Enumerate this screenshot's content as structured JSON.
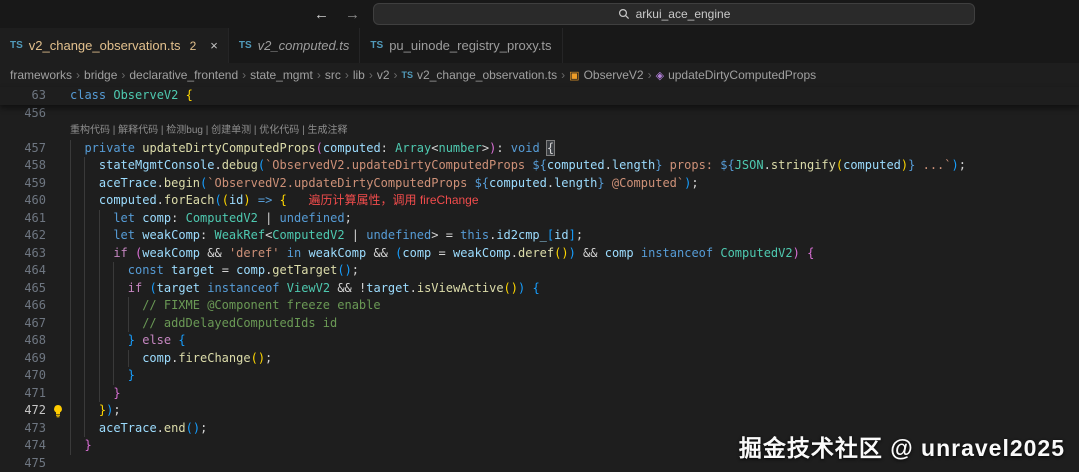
{
  "title_bar": {
    "back_arrow": "←",
    "forward_arrow": "→",
    "search_value": "arkui_ace_engine"
  },
  "tabs": [
    {
      "icon": "TS",
      "label": "v2_change_observation.ts",
      "badge": "2",
      "active": true,
      "close": "×"
    },
    {
      "icon": "TS",
      "label": "v2_computed.ts",
      "preview": true
    },
    {
      "icon": "TS",
      "label": "pu_uinode_registry_proxy.ts"
    }
  ],
  "breadcrumb": [
    {
      "label": "frameworks"
    },
    {
      "label": "bridge"
    },
    {
      "label": "declarative_frontend"
    },
    {
      "label": "state_mgmt"
    },
    {
      "label": "src"
    },
    {
      "label": "lib"
    },
    {
      "label": "v2"
    },
    {
      "label": "v2_change_observation.ts",
      "icon": "ts"
    },
    {
      "label": "ObserveV2",
      "icon": "class"
    },
    {
      "label": "updateDirtyComputedProps",
      "icon": "method"
    }
  ],
  "editor": {
    "codelens_actions": [
      "重构代码",
      "解释代码",
      "检测bug",
      "创建单测",
      "优化代码",
      "生成注释"
    ],
    "annotation": "遍历计算属性，调用 fireChange",
    "sticky_line": {
      "num": "63",
      "indent": 0,
      "tokens": [
        [
          "class",
          "kw"
        ],
        [
          " ",
          "df"
        ],
        [
          "ObserveV2",
          "ty"
        ],
        [
          " ",
          "df"
        ],
        [
          "{",
          "b1"
        ]
      ]
    },
    "lines": [
      {
        "num": "456",
        "indent": 0,
        "tokens": []
      },
      {
        "num": "",
        "lens": true
      },
      {
        "num": "457",
        "indent": 1,
        "tokens": [
          [
            "private",
            "kw"
          ],
          [
            " ",
            "df"
          ],
          [
            "updateDirtyComputedProps",
            "fn"
          ],
          [
            "(",
            "b2"
          ],
          [
            "computed",
            "vr"
          ],
          [
            ": ",
            "df"
          ],
          [
            "Array",
            "ty"
          ],
          [
            "<",
            "df"
          ],
          [
            "number",
            "ty"
          ],
          [
            ">",
            "df"
          ],
          [
            ")",
            "b2"
          ],
          [
            ": ",
            "df"
          ],
          [
            "void",
            "kw"
          ],
          [
            " ",
            "df"
          ],
          [
            "{",
            "bm"
          ]
        ]
      },
      {
        "num": "458",
        "indent": 2,
        "tokens": [
          [
            "stateMgmtConsole",
            "vr"
          ],
          [
            ".",
            "df"
          ],
          [
            "debug",
            "fn"
          ],
          [
            "(",
            "b3"
          ],
          [
            "`ObservedV2.updateDirtyComputedProps ",
            "st"
          ],
          [
            "${",
            "pt"
          ],
          [
            "computed",
            "vr"
          ],
          [
            ".",
            "df"
          ],
          [
            "length",
            "vr"
          ],
          [
            "}",
            "pt"
          ],
          [
            " props: ",
            "st"
          ],
          [
            "${",
            "pt"
          ],
          [
            "JSON",
            "ty"
          ],
          [
            ".",
            "df"
          ],
          [
            "stringify",
            "fn"
          ],
          [
            "(",
            "b1"
          ],
          [
            "computed",
            "vr"
          ],
          [
            ")",
            "b1"
          ],
          [
            "}",
            "pt"
          ],
          [
            " ...`",
            "st"
          ],
          [
            ")",
            "b3"
          ],
          [
            ";",
            "df"
          ]
        ]
      },
      {
        "num": "459",
        "indent": 2,
        "tokens": [
          [
            "aceTrace",
            "vr"
          ],
          [
            ".",
            "df"
          ],
          [
            "begin",
            "fn"
          ],
          [
            "(",
            "b3"
          ],
          [
            "`ObservedV2.updateDirtyComputedProps ",
            "st"
          ],
          [
            "${",
            "pt"
          ],
          [
            "computed",
            "vr"
          ],
          [
            ".",
            "df"
          ],
          [
            "length",
            "vr"
          ],
          [
            "}",
            "pt"
          ],
          [
            " @Computed`",
            "st"
          ],
          [
            ")",
            "b3"
          ],
          [
            ";",
            "df"
          ]
        ]
      },
      {
        "num": "460",
        "indent": 2,
        "tokens": [
          [
            "computed",
            "vr"
          ],
          [
            ".",
            "df"
          ],
          [
            "forEach",
            "fn"
          ],
          [
            "(",
            "b3"
          ],
          [
            "(",
            "b1"
          ],
          [
            "id",
            "vr"
          ],
          [
            ")",
            "b1"
          ],
          [
            " ",
            "df"
          ],
          [
            "=>",
            "kw"
          ],
          [
            " ",
            "df"
          ],
          [
            "{",
            "b1"
          ],
          [
            "   ",
            "df"
          ],
          [
            "遍历计算属性，调用 fireChange",
            "an"
          ]
        ]
      },
      {
        "num": "461",
        "indent": 3,
        "tokens": [
          [
            "let",
            "kw"
          ],
          [
            " ",
            "df"
          ],
          [
            "comp",
            "vr"
          ],
          [
            ": ",
            "df"
          ],
          [
            "ComputedV2",
            "ty"
          ],
          [
            " | ",
            "df"
          ],
          [
            "undefined",
            "kw"
          ],
          [
            ";",
            "df"
          ]
        ]
      },
      {
        "num": "462",
        "indent": 3,
        "tokens": [
          [
            "let",
            "kw"
          ],
          [
            " ",
            "df"
          ],
          [
            "weakComp",
            "vr"
          ],
          [
            ": ",
            "df"
          ],
          [
            "WeakRef",
            "ty"
          ],
          [
            "<",
            "df"
          ],
          [
            "ComputedV2",
            "ty"
          ],
          [
            " | ",
            "df"
          ],
          [
            "undefined",
            "kw"
          ],
          [
            "> = ",
            "df"
          ],
          [
            "this",
            "kw"
          ],
          [
            ".",
            "df"
          ],
          [
            "id2cmp_",
            "vr"
          ],
          [
            "[",
            "b3"
          ],
          [
            "id",
            "vr"
          ],
          [
            "]",
            "b3"
          ],
          [
            ";",
            "df"
          ]
        ]
      },
      {
        "num": "463",
        "indent": 3,
        "tokens": [
          [
            "if",
            "ctl"
          ],
          [
            " ",
            "df"
          ],
          [
            "(",
            "b2"
          ],
          [
            "weakComp",
            "vr"
          ],
          [
            " && ",
            "df"
          ],
          [
            "'deref'",
            "st"
          ],
          [
            " ",
            "df"
          ],
          [
            "in",
            "kw"
          ],
          [
            " ",
            "df"
          ],
          [
            "weakComp",
            "vr"
          ],
          [
            " && ",
            "df"
          ],
          [
            "(",
            "b3"
          ],
          [
            "comp",
            "vr"
          ],
          [
            " = ",
            "df"
          ],
          [
            "weakComp",
            "vr"
          ],
          [
            ".",
            "df"
          ],
          [
            "deref",
            "fn"
          ],
          [
            "(",
            "b1"
          ],
          [
            ")",
            "b1"
          ],
          [
            ")",
            "b3"
          ],
          [
            " && ",
            "df"
          ],
          [
            "comp",
            "vr"
          ],
          [
            " ",
            "df"
          ],
          [
            "instanceof",
            "kw"
          ],
          [
            " ",
            "df"
          ],
          [
            "ComputedV2",
            "ty"
          ],
          [
            ")",
            "b2"
          ],
          [
            " ",
            "df"
          ],
          [
            "{",
            "b2"
          ]
        ]
      },
      {
        "num": "464",
        "indent": 4,
        "tokens": [
          [
            "const",
            "kw"
          ],
          [
            " ",
            "df"
          ],
          [
            "target",
            "vr"
          ],
          [
            " = ",
            "df"
          ],
          [
            "comp",
            "vr"
          ],
          [
            ".",
            "df"
          ],
          [
            "getTarget",
            "fn"
          ],
          [
            "(",
            "b3"
          ],
          [
            ")",
            "b3"
          ],
          [
            ";",
            "df"
          ]
        ]
      },
      {
        "num": "465",
        "indent": 4,
        "tokens": [
          [
            "if",
            "ctl"
          ],
          [
            " ",
            "df"
          ],
          [
            "(",
            "b3"
          ],
          [
            "target",
            "vr"
          ],
          [
            " ",
            "df"
          ],
          [
            "instanceof",
            "kw"
          ],
          [
            " ",
            "df"
          ],
          [
            "ViewV2",
            "ty"
          ],
          [
            " && ",
            "df"
          ],
          [
            "!",
            "df"
          ],
          [
            "target",
            "vr"
          ],
          [
            ".",
            "df"
          ],
          [
            "isViewActive",
            "fn"
          ],
          [
            "(",
            "b1"
          ],
          [
            ")",
            "b1"
          ],
          [
            ")",
            "b3"
          ],
          [
            " ",
            "df"
          ],
          [
            "{",
            "b3"
          ]
        ]
      },
      {
        "num": "466",
        "indent": 5,
        "tokens": [
          [
            "// FIXME @Component freeze enable",
            "cm"
          ]
        ]
      },
      {
        "num": "467",
        "indent": 5,
        "tokens": [
          [
            "// addDelayedComputedIds id",
            "cm"
          ]
        ]
      },
      {
        "num": "468",
        "indent": 4,
        "tokens": [
          [
            "}",
            "b3"
          ],
          [
            " ",
            "df"
          ],
          [
            "else",
            "ctl"
          ],
          [
            " ",
            "df"
          ],
          [
            "{",
            "b3"
          ]
        ]
      },
      {
        "num": "469",
        "indent": 5,
        "tokens": [
          [
            "comp",
            "vr"
          ],
          [
            ".",
            "df"
          ],
          [
            "fireChange",
            "fn"
          ],
          [
            "(",
            "b1"
          ],
          [
            ")",
            "b1"
          ],
          [
            ";",
            "df"
          ]
        ]
      },
      {
        "num": "470",
        "indent": 4,
        "tokens": [
          [
            "}",
            "b3"
          ]
        ]
      },
      {
        "num": "471",
        "indent": 3,
        "tokens": [
          [
            "}",
            "b2"
          ]
        ]
      },
      {
        "num": "472",
        "indent": 2,
        "bulb": true,
        "current": true,
        "tokens": [
          [
            "}",
            "b1"
          ],
          [
            ")",
            "b3"
          ],
          [
            ";",
            "df"
          ]
        ]
      },
      {
        "num": "473",
        "indent": 2,
        "tokens": [
          [
            "aceTrace",
            "vr"
          ],
          [
            ".",
            "df"
          ],
          [
            "end",
            "fn"
          ],
          [
            "(",
            "b3"
          ],
          [
            ")",
            "b3"
          ],
          [
            ";",
            "df"
          ]
        ]
      },
      {
        "num": "474",
        "indent": 1,
        "tokens": [
          [
            "}",
            "b2"
          ]
        ]
      },
      {
        "num": "475",
        "indent": 0,
        "tokens": []
      }
    ]
  },
  "watermark": "掘金技术社区 @ unravel2025",
  "colors": {
    "tab_modified": "#e2c08d",
    "annotation_red": "#f14c4c",
    "bulb_yellow": "#ffcc00",
    "ts_icon_blue": "#519aba",
    "editor_bg": "#1e1e1e",
    "chrome_bg": "#181818"
  }
}
